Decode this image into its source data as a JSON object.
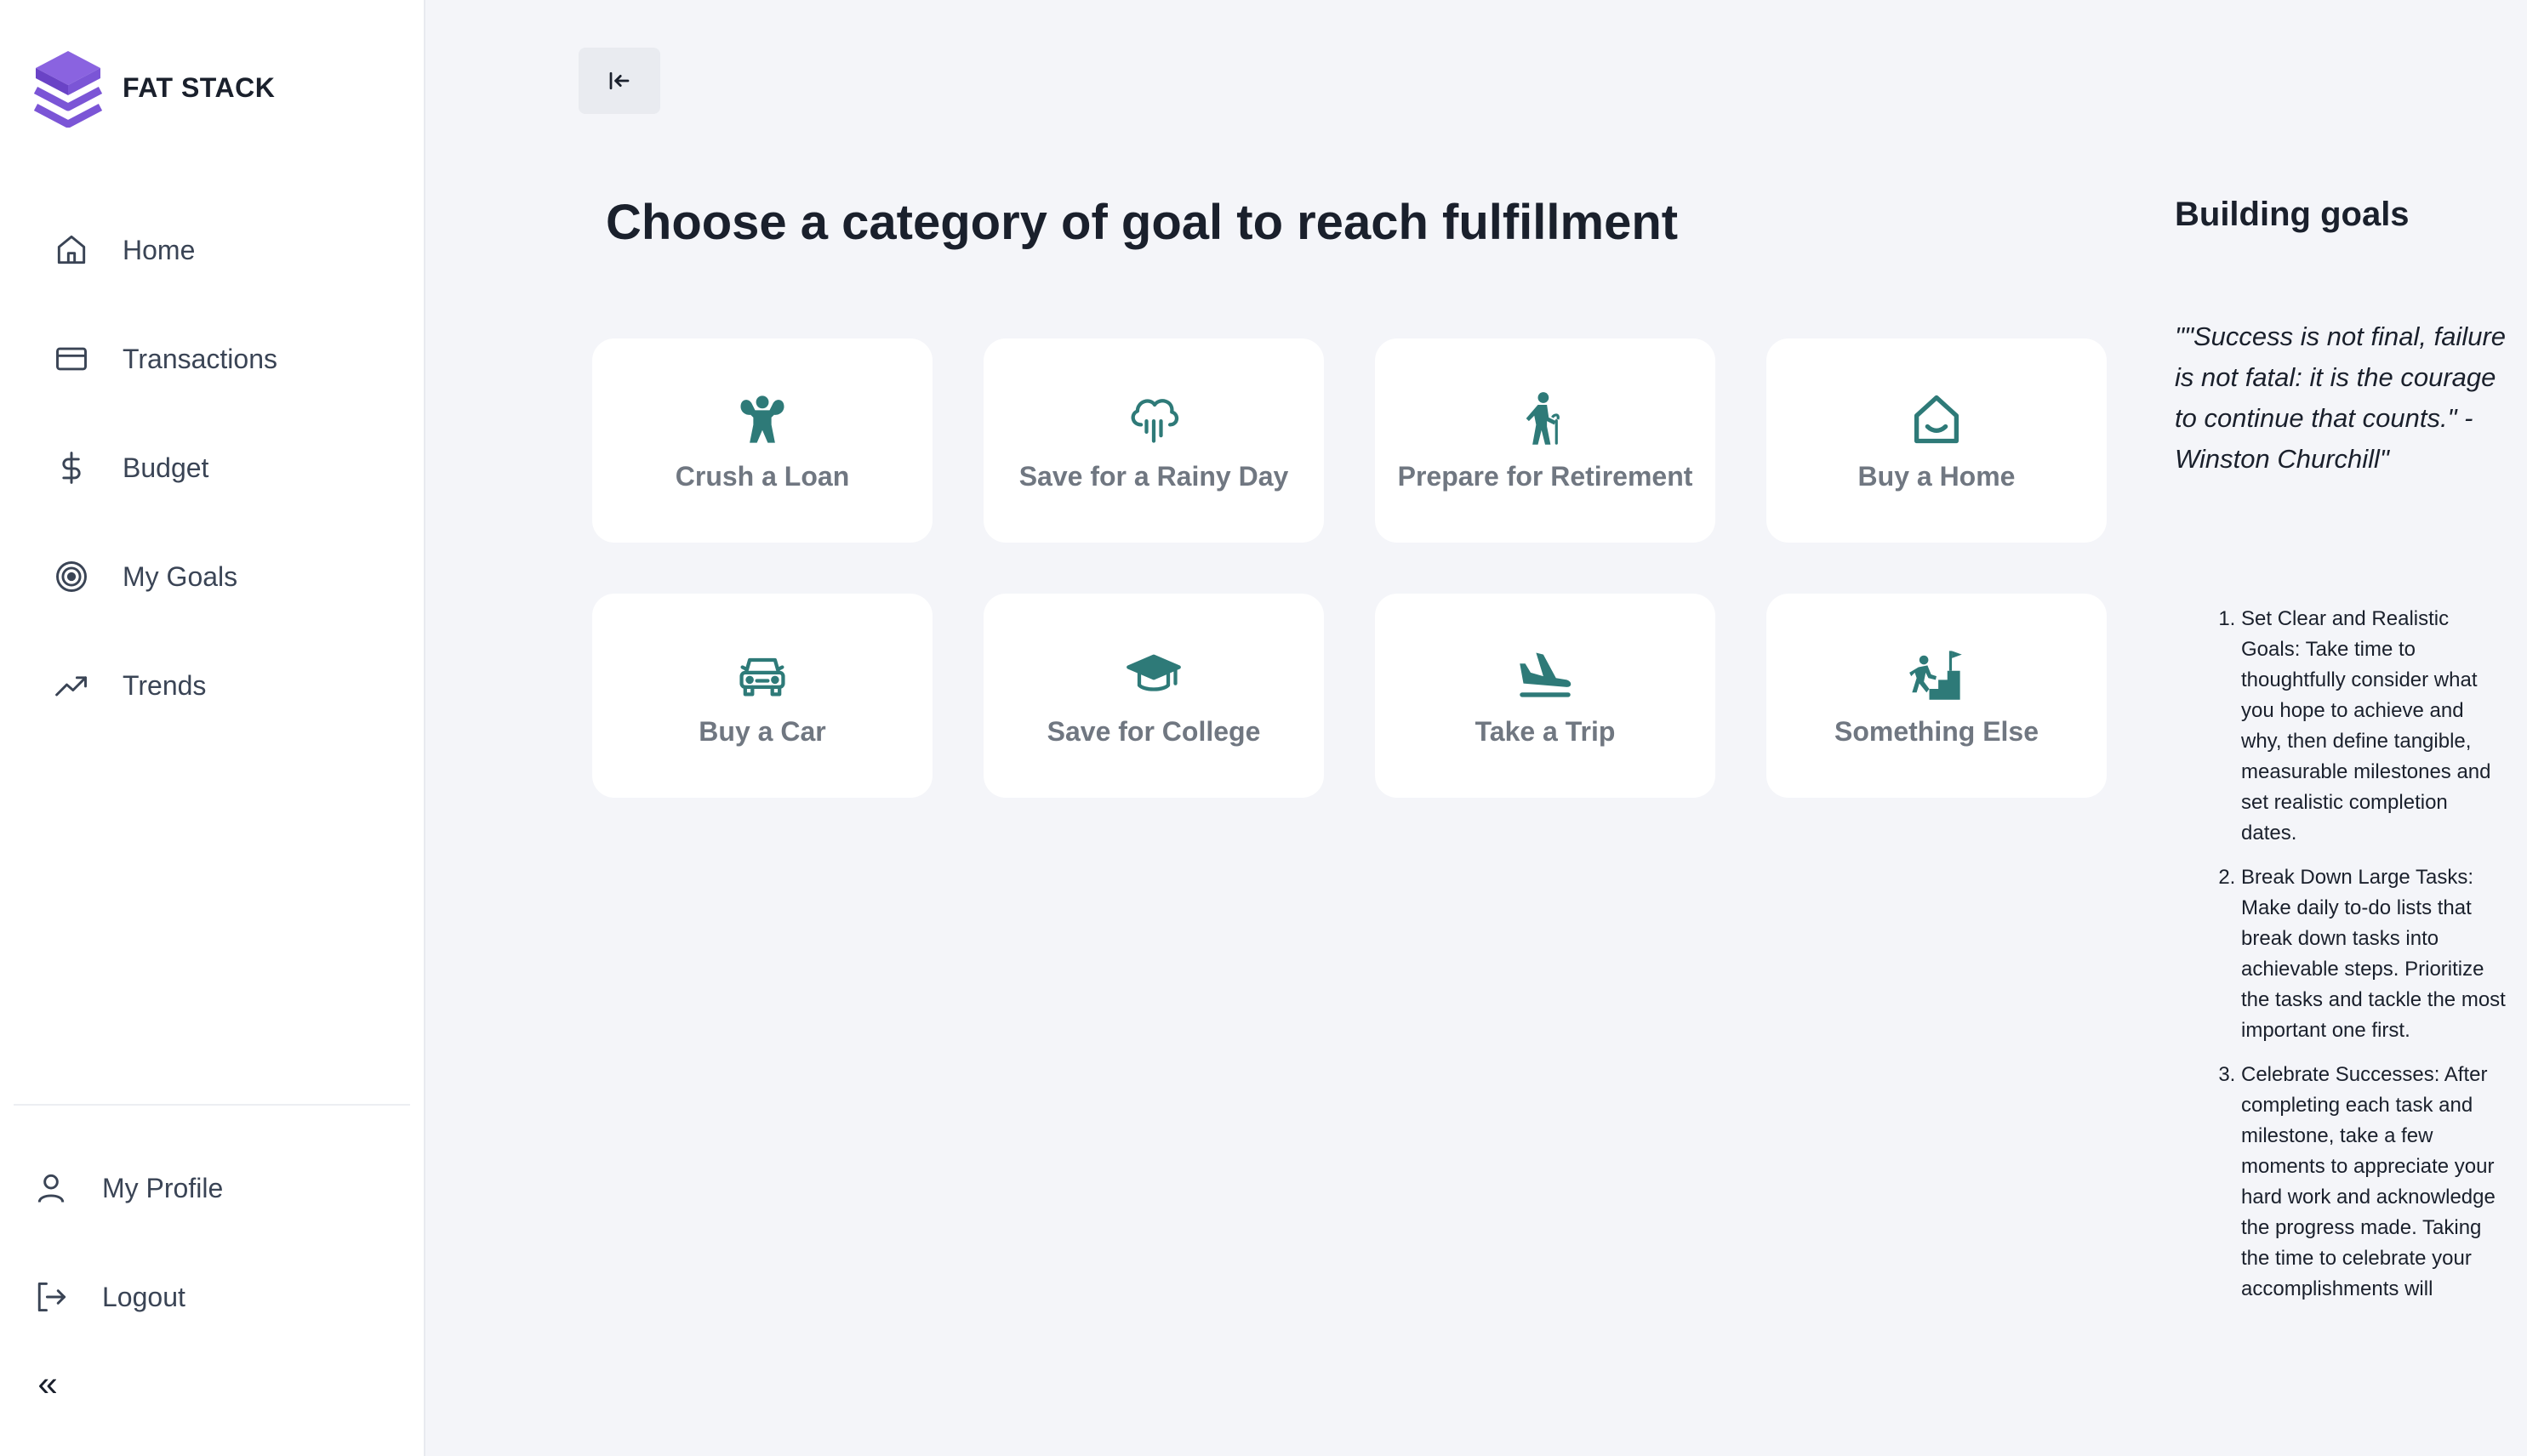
{
  "brand": {
    "name": "FAT STACK"
  },
  "sidebar": {
    "items": [
      {
        "label": "Home",
        "icon": "home-icon"
      },
      {
        "label": "Transactions",
        "icon": "credit-card-icon"
      },
      {
        "label": "Budget",
        "icon": "dollar-icon"
      },
      {
        "label": "My Goals",
        "icon": "target-icon"
      },
      {
        "label": "Trends",
        "icon": "trending-up-icon"
      }
    ],
    "bottom_items": [
      {
        "label": "My Profile",
        "icon": "user-icon"
      },
      {
        "label": "Logout",
        "icon": "logout-icon"
      }
    ],
    "collapse_glyph": "«"
  },
  "main": {
    "title": "Choose a category of goal to reach fulfillment",
    "categories": [
      {
        "label": "Crush a Loan",
        "icon": "strongman-icon"
      },
      {
        "label": "Save for a Rainy Day",
        "icon": "rain-cloud-icon"
      },
      {
        "label": "Prepare for Retirement",
        "icon": "elder-walking-icon"
      },
      {
        "label": "Buy a Home",
        "icon": "house-icon"
      },
      {
        "label": "Buy a Car",
        "icon": "car-icon"
      },
      {
        "label": "Save for College",
        "icon": "graduation-cap-icon"
      },
      {
        "label": "Take a Trip",
        "icon": "airplane-landing-icon"
      },
      {
        "label": "Something Else",
        "icon": "climbing-stairs-flag-icon"
      }
    ]
  },
  "aside": {
    "title": "Building goals",
    "quote": "\"\"Success is not final, failure is not fatal: it is the courage to continue that counts.\" - Winston Churchill\"",
    "tips": [
      "Set Clear and Realistic Goals: Take time to thoughtfully consider what you hope to achieve and why, then define tangible, measurable milestones and set realistic completion dates.",
      "Break Down Large Tasks: Make daily to-do lists that break down tasks into achievable steps. Prioritize the tasks and tackle the most important one first.",
      "Celebrate Successes: After completing each task and milestone, take a few moments to appreciate your hard work and acknowledge the progress made. Taking the time to celebrate your accomplishments will"
    ]
  },
  "colors": {
    "accent_teal": "#2e7a78",
    "brand_purple": "#7b55d6",
    "background": "#f4f5f9"
  }
}
